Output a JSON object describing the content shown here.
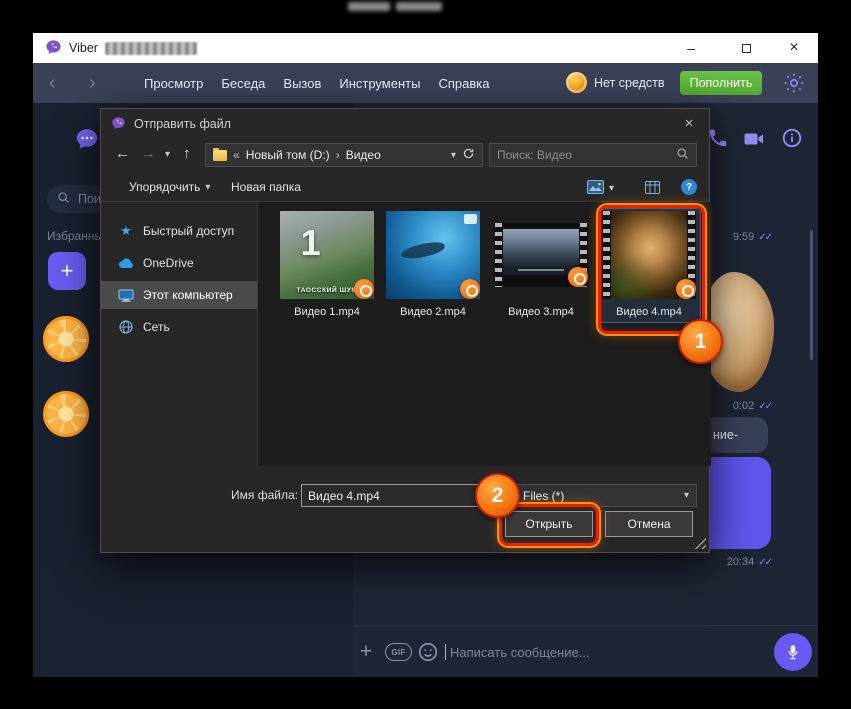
{
  "glyphs": {
    "chevron_down": "▾",
    "plus": "+",
    "close": "×",
    "minimize": "–",
    "double_check": "✓✓",
    "back": "‹",
    "forward": "›"
  },
  "titlebar": {
    "app_name": "Viber"
  },
  "menubar": {
    "items": [
      "Просмотр",
      "Беседа",
      "Вызов",
      "Инструменты",
      "Справка"
    ],
    "balance_label": "Нет средств",
    "topup_label": "Пополнить"
  },
  "chat_list": {
    "search_placeholder": "Поиск",
    "section_label": "Избранные"
  },
  "chat": {
    "ts1": "9:59",
    "ts2": "0:02",
    "ts3": "20:34",
    "fragment": "ние-",
    "composer": {
      "placeholder": "Написать сообщение...",
      "gif_label": "GIF"
    }
  },
  "dialog": {
    "title": "Отправить файл",
    "toolbar": {
      "back": "←",
      "forward": "→",
      "up": "↑",
      "breadcrumb_prefix": "«",
      "breadcrumb_root": "Новый том (D:)",
      "breadcrumb_sep": "›",
      "breadcrumb_current": "Видео",
      "search_placeholder": "Поиск: Видео"
    },
    "commandbar": {
      "organize": "Упорядочить",
      "new_folder": "Новая папка",
      "help": "?"
    },
    "nav_items": [
      {
        "label": "Быстрый доступ"
      },
      {
        "label": "OneDrive"
      },
      {
        "label": "Этот компьютер"
      },
      {
        "label": "Сеть"
      }
    ],
    "files": [
      {
        "name": "Видео 1.mp4",
        "overlay_number": "1",
        "caption": "ТАОССКИЙ ШУМ"
      },
      {
        "name": "Видео 2.mp4"
      },
      {
        "name": "Видео 3.mp4"
      },
      {
        "name": "Видео 4.mp4"
      }
    ],
    "footer": {
      "filename_label": "Имя файла:",
      "filename_value": "Видео 4.mp4",
      "filetype_value": "Files (*)",
      "open_label": "Открыть",
      "cancel_label": "Отмена"
    }
  },
  "annotations": {
    "step1": "1",
    "step2": "2"
  },
  "colors": {
    "accent_purple": "#7360f2",
    "annotation_red": "#e6230a",
    "annotation_orange": "#ff9300",
    "topup_green": "#5cb33a"
  }
}
